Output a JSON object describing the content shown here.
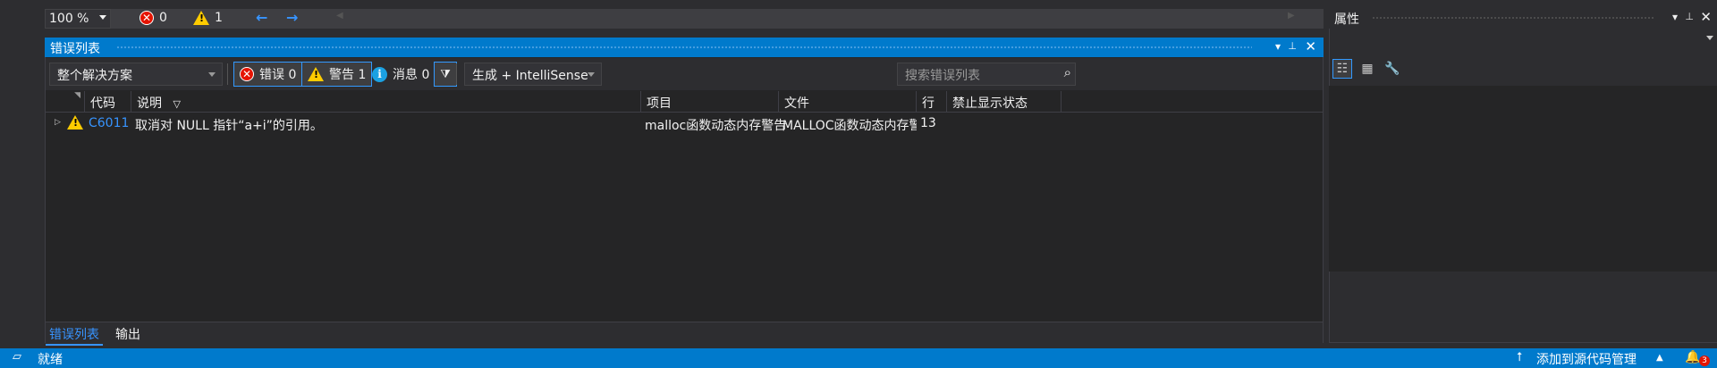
{
  "zoom_bar": {
    "zoom": "100 %",
    "errors": "0",
    "warnings": "1",
    "nav_back": "←",
    "nav_forward": "→",
    "nav_left": "◀",
    "nav_right": "▶"
  },
  "error_list": {
    "title": "错误列表",
    "title_controls": {
      "dropdown": "▾",
      "pin": "📌",
      "close": "✕"
    },
    "scope": "整个解决方案",
    "errors_btn": "错误 0",
    "warnings_btn": "警告 1",
    "messages_btn": "消息 0",
    "build_filter": "生成 + IntelliSense",
    "search_placeholder": "搜索错误列表",
    "columns": [
      "代码",
      "说明",
      "项目",
      "文件",
      "行",
      "禁止显示状态"
    ],
    "rows": [
      {
        "code": "C6011",
        "description": "取消对 NULL 指针“a+i”的引用。",
        "project": "malloc函数动态内存警告",
        "file": "MALLOC函数动态内存警...",
        "line": "13",
        "suppression": ""
      }
    ],
    "bottom_tabs": [
      "错误列表",
      "输出"
    ]
  },
  "properties": {
    "title": "属性"
  },
  "status_bar": {
    "ready": "就绪",
    "source_control": "添加到源代码管理",
    "notifications": "3"
  },
  "colors": {
    "accent": "#007acc",
    "link": "#3794ff",
    "error": "#e51400",
    "warning": "#ffcc00",
    "info": "#1ba1e2"
  }
}
